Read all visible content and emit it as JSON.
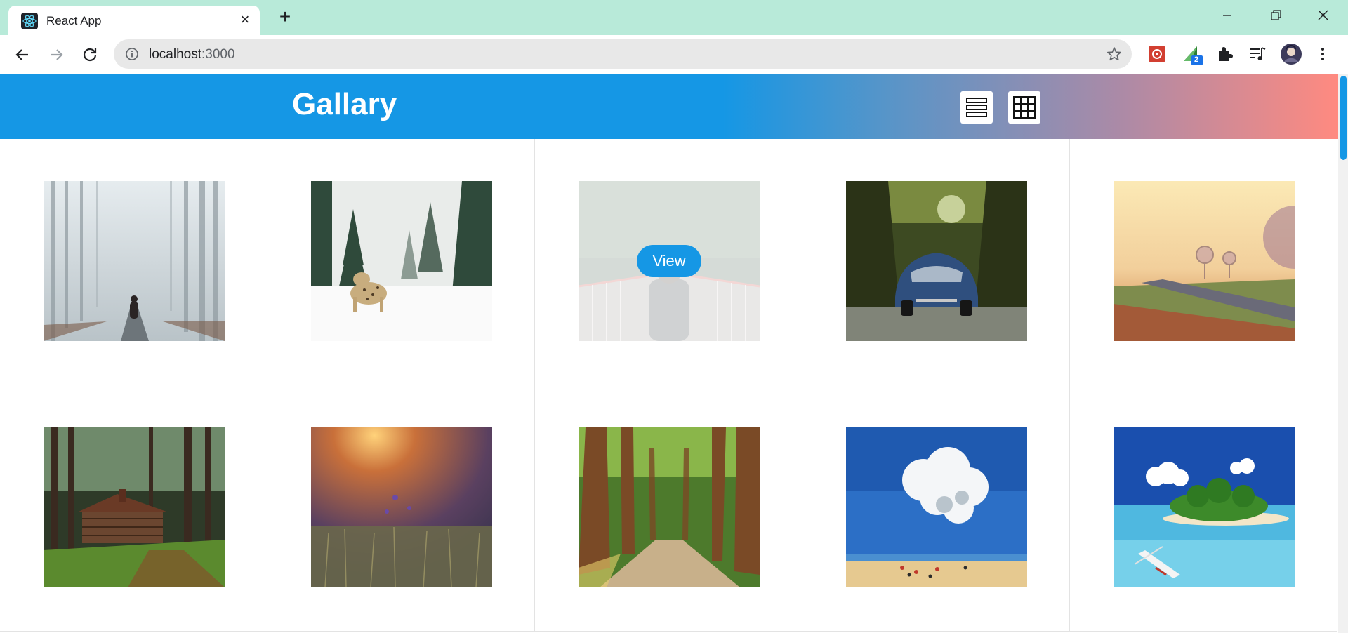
{
  "browser": {
    "tab_title": "React App",
    "url_host": "localhost",
    "url_port": ":3000",
    "extension_badge": "2",
    "colors": {
      "titlebar": "#b8ead9",
      "omnibox": "#e8e8e8"
    }
  },
  "app": {
    "title": "Gallary",
    "colors": {
      "header_start": "#1597e5",
      "header_end": "#ff8a80",
      "button": "#1597e5"
    },
    "view_toggles": [
      {
        "icon": "list-view-icon"
      },
      {
        "icon": "grid-view-icon"
      }
    ],
    "hover_button_label": "View",
    "images": [
      {
        "subject": "person on misty forest road"
      },
      {
        "subject": "leopard in snowy forest"
      },
      {
        "subject": "person on bridge",
        "hovered": true
      },
      {
        "subject": "blue beetle car on forest road"
      },
      {
        "subject": "foggy sunrise roadside trees"
      },
      {
        "subject": "log cabin in forest"
      },
      {
        "subject": "field of flowers at sunset"
      },
      {
        "subject": "tree lined path"
      },
      {
        "subject": "beach with cloud"
      },
      {
        "subject": "tropical island with boat"
      }
    ]
  }
}
